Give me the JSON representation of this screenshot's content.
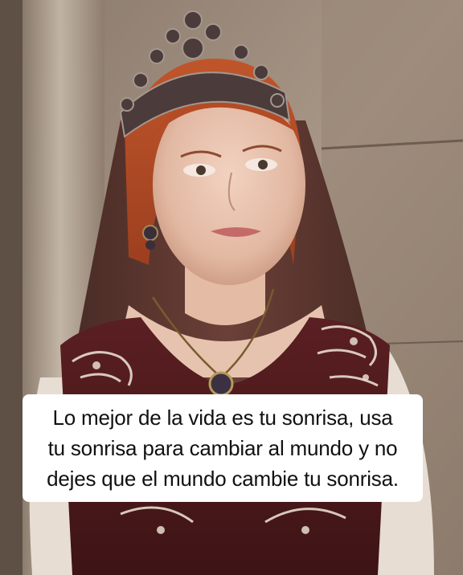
{
  "caption": {
    "lines": [
      "Lo mejor de la vida es tu sonrisa, usa",
      "tu sonrisa para cambiar al mundo y no",
      "dejes que el mundo cambie tu sonrisa."
    ]
  },
  "image": {
    "subject": "woman-in-crown-and-veil-photo"
  }
}
